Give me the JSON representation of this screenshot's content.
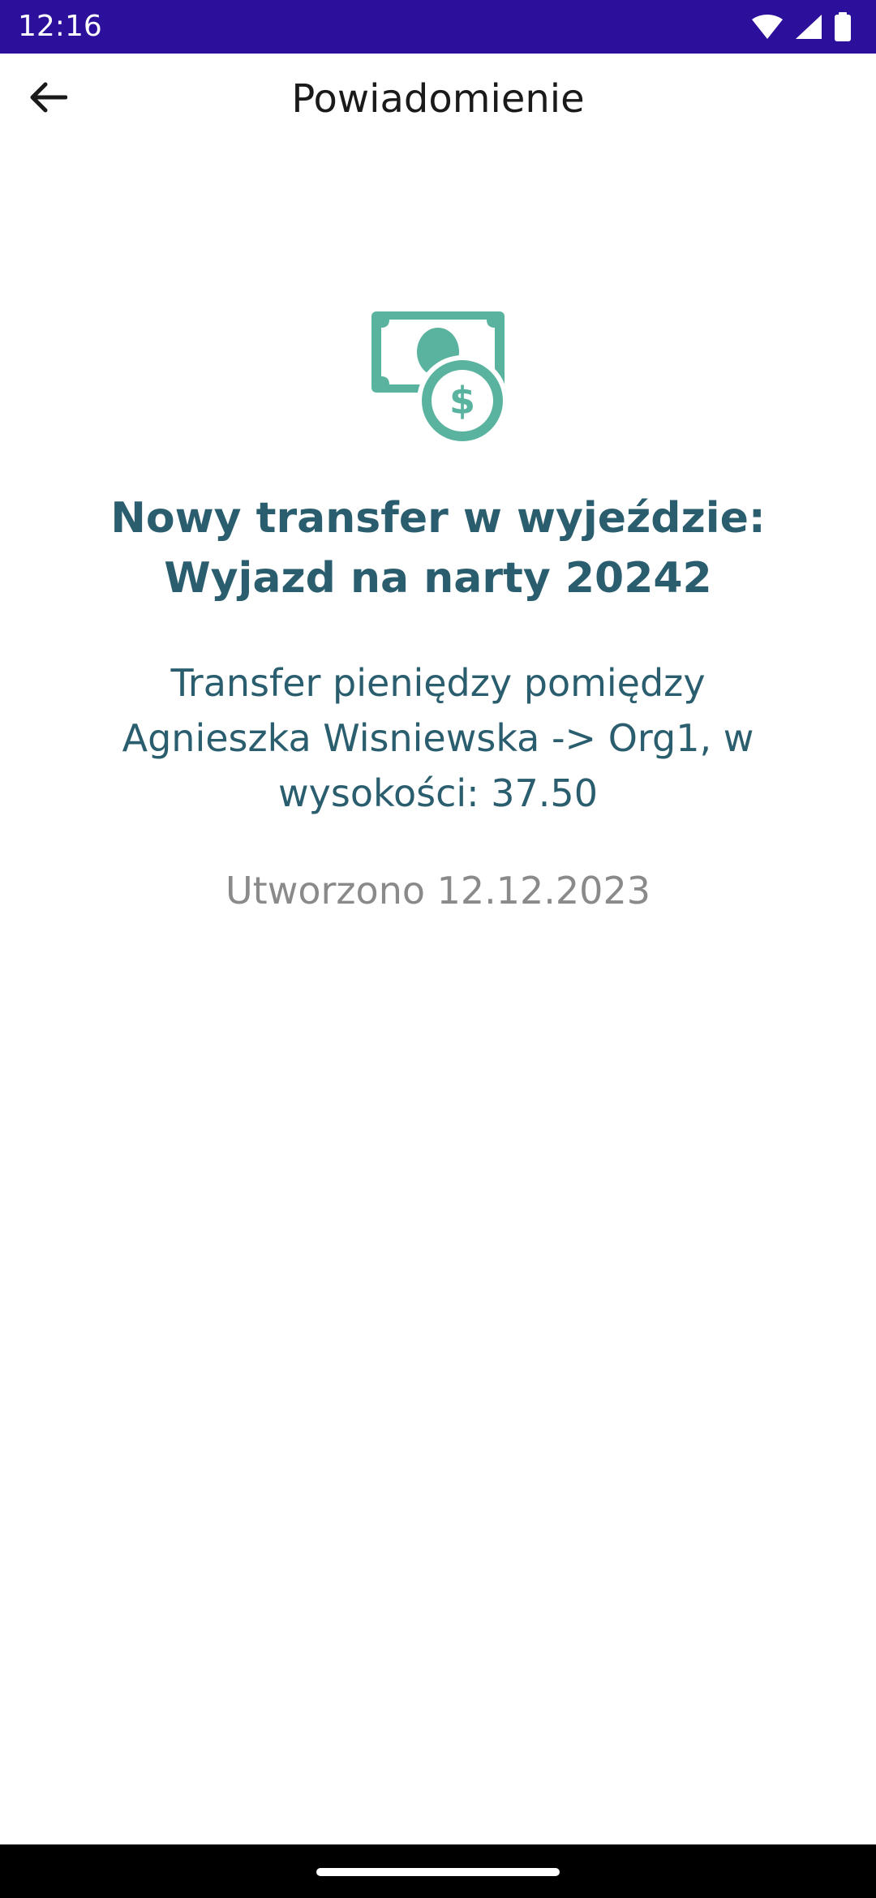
{
  "status_bar": {
    "time": "12:16",
    "icons": [
      "wifi-icon",
      "signal-icon",
      "battery-icon"
    ],
    "background_color": "#2c0f9b"
  },
  "app_bar": {
    "title": "Powiadomienie",
    "back_icon": "arrow-back-icon"
  },
  "notification": {
    "icon": "money-transfer-icon",
    "icon_color": "#5ab39e",
    "title": "Nowy transfer w wyjeździe: Wyjazd na narty 20242",
    "body": "Transfer pieniędzy pomiędzy Agnieszka Wisniewska -> Org1, w wysokości: 37.50",
    "created": "Utworzono 12.12.2023",
    "text_color": "#2a5e6e",
    "date_color": "#8a8a8a"
  },
  "nav_bar": {
    "handle": "home-gesture-handle"
  }
}
